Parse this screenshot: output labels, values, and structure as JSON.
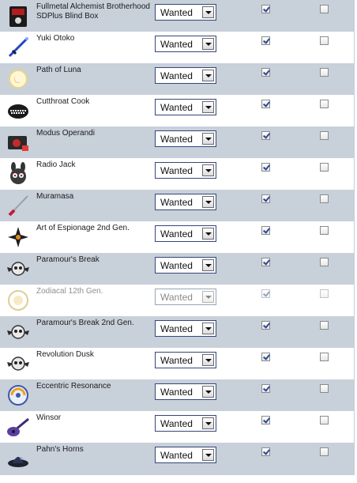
{
  "status_options": [
    "Wanted"
  ],
  "items": [
    {
      "name": "Fullmetal Alchemist Brotherhood SDPlus Blind Box",
      "status": "Wanted",
      "col1_checked": true,
      "col2_checked": false,
      "icon": "black-box-icon"
    },
    {
      "name": "Yuki Otoko",
      "status": "Wanted",
      "col1_checked": true,
      "col2_checked": false,
      "icon": "blue-sword-icon"
    },
    {
      "name": "Path of Luna",
      "status": "Wanted",
      "col1_checked": true,
      "col2_checked": false,
      "icon": "moon-orb-icon"
    },
    {
      "name": "Cutthroat Cook",
      "status": "Wanted",
      "col1_checked": true,
      "col2_checked": false,
      "icon": "grinning-mouth-icon"
    },
    {
      "name": "Modus Operandi",
      "status": "Wanted",
      "col1_checked": true,
      "col2_checked": false,
      "icon": "red-camera-icon"
    },
    {
      "name": "Radio Jack",
      "status": "Wanted",
      "col1_checked": true,
      "col2_checked": false,
      "icon": "bunny-mask-icon"
    },
    {
      "name": "Muramasa",
      "status": "Wanted",
      "col1_checked": true,
      "col2_checked": false,
      "icon": "red-katana-icon"
    },
    {
      "name": "Art of Espionage 2nd Gen.",
      "status": "Wanted",
      "col1_checked": true,
      "col2_checked": false,
      "icon": "shuriken-icon"
    },
    {
      "name": "Paramour's Break",
      "status": "Wanted",
      "col1_checked": true,
      "col2_checked": false,
      "icon": "winged-skull-icon"
    },
    {
      "name": "Zodiacal 12th Gen.",
      "status": "Wanted",
      "col1_checked": true,
      "col2_checked": false,
      "icon": "zodiac-sun-icon"
    },
    {
      "name": "Paramour's Break 2nd Gen.",
      "status": "Wanted",
      "col1_checked": true,
      "col2_checked": false,
      "icon": "winged-skull-icon"
    },
    {
      "name": "Revolution Dusk",
      "status": "Wanted",
      "col1_checked": true,
      "col2_checked": false,
      "icon": "winged-skull-icon"
    },
    {
      "name": "Eccentric Resonance",
      "status": "Wanted",
      "col1_checked": true,
      "col2_checked": false,
      "icon": "dusk-swirl-icon"
    },
    {
      "name": "Winsor",
      "status": "Wanted",
      "col1_checked": true,
      "col2_checked": false,
      "icon": "purple-guitar-icon"
    },
    {
      "name": "Pahn's Horns",
      "status": "Wanted",
      "col1_checked": true,
      "col2_checked": false,
      "icon": "dark-hat-icon"
    }
  ],
  "extra_item": {
    "name": "Pahn's Horns",
    "status": "Wanted",
    "col1_checked": true,
    "col2_checked": false,
    "icon": "curled-horns-icon"
  }
}
